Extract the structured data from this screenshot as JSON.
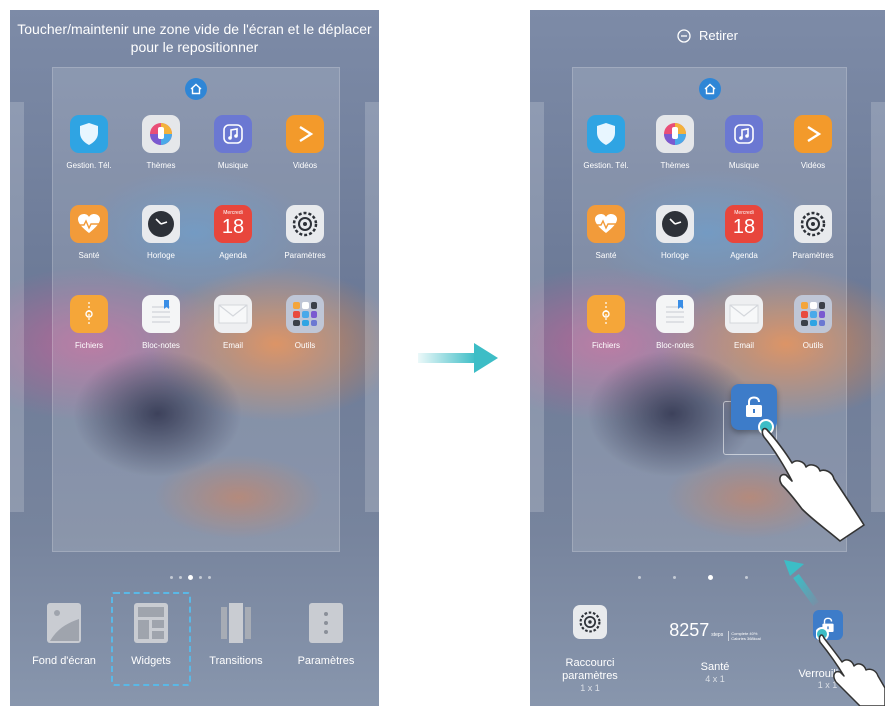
{
  "left_screen": {
    "instruction_line1": "Toucher/maintenir une zone vide de l'écran et le déplacer",
    "instruction_line2": "pour le repositionner",
    "apps": [
      {
        "label": "Gestion. Tél.",
        "icon": "shield-icon",
        "color": "#2fa4e3"
      },
      {
        "label": "Thèmes",
        "icon": "brush-icon",
        "color": "#e5e7ea"
      },
      {
        "label": "Musique",
        "icon": "music-note-icon",
        "color": "#6b78d2"
      },
      {
        "label": "Vidéos",
        "icon": "play-icon",
        "color": "#f39a2b"
      },
      {
        "label": "Santé",
        "icon": "heart-icon",
        "color": "#f29b3a"
      },
      {
        "label": "Horloge",
        "icon": "clock-icon",
        "color": "#e8eaed"
      },
      {
        "label": "Agenda",
        "icon": "calendar-icon",
        "color": "#e8463c",
        "day_name": "Mercredi",
        "day_number": "18"
      },
      {
        "label": "Paramètres",
        "icon": "gear-icon",
        "color": "#e8eaed"
      },
      {
        "label": "Fichiers",
        "icon": "folder-icon",
        "color": "#f5a639"
      },
      {
        "label": "Bloc-notes",
        "icon": "notepad-icon",
        "color": "#f4f5f6"
      },
      {
        "label": "Email",
        "icon": "envelope-icon",
        "color": "#eeeff1"
      },
      {
        "label": "Outils",
        "icon": "folder-grid-icon",
        "color": "#bfc6d6"
      }
    ],
    "bottom_menu": [
      {
        "label": "Fond d'écran",
        "icon": "wallpaper-icon"
      },
      {
        "label": "Widgets",
        "icon": "widgets-icon"
      },
      {
        "label": "Transitions",
        "icon": "transitions-icon"
      },
      {
        "label": "Paramètres",
        "icon": "settings-dots-icon"
      }
    ]
  },
  "right_screen": {
    "retirer_label": "Retirer",
    "apps": [
      {
        "label": "Gestion. Tél."
      },
      {
        "label": "Thèmes"
      },
      {
        "label": "Musique"
      },
      {
        "label": "Vidéos"
      },
      {
        "label": "Santé"
      },
      {
        "label": "Horloge"
      },
      {
        "label": "Agenda",
        "day_name": "Mercredi",
        "day_number": "18"
      },
      {
        "label": "Paramètres"
      },
      {
        "label": "Fichiers"
      },
      {
        "label": "Bloc-notes"
      },
      {
        "label": "Email"
      },
      {
        "label": "Outils"
      }
    ],
    "widgets": [
      {
        "label_line1": "Raccourci",
        "label_line2": "paramètres",
        "size": "1 x 1"
      },
      {
        "steps": "8257",
        "steps_unit": "steps",
        "label_line1": "Santé",
        "size": "4 x 1",
        "detail_line1": "Complete 40%",
        "detail_line2": "Calories 368kcal"
      },
      {
        "label_line1": "Verrouillage",
        "size": "1 x 1"
      }
    ]
  },
  "colors": {
    "arrow": "#3dbdc6",
    "accent_blue": "#2f86d6",
    "lock_blue": "#3d7cc9"
  }
}
